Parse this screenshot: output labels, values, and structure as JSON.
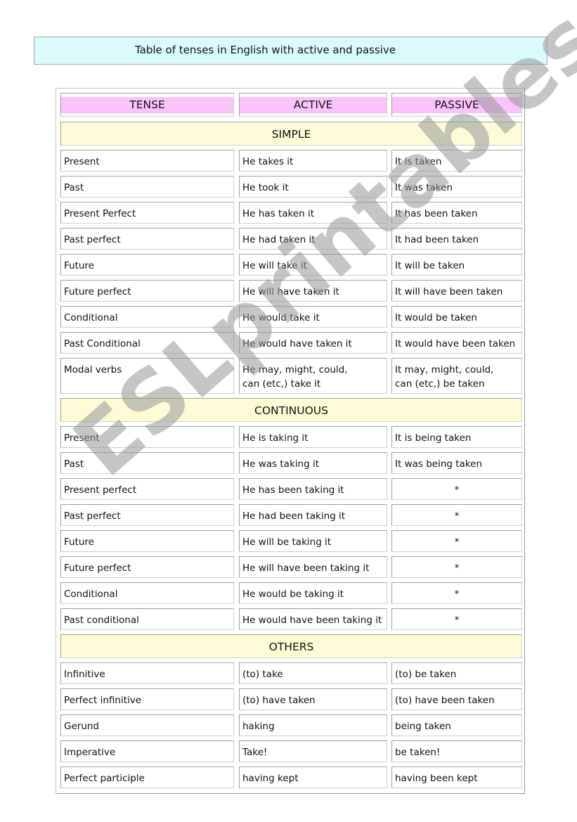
{
  "title": "Table of tenses in English with active and passive",
  "columns": [
    "TENSE",
    "ACTIVE",
    "PASSIVE"
  ],
  "sections": [
    {
      "name": "SIMPLE",
      "rows": [
        [
          "Present",
          "He takes it",
          "It is taken"
        ],
        [
          "Past",
          "He took it",
          "It was taken"
        ],
        [
          "Present Perfect",
          "He has taken it",
          "It has been taken"
        ],
        [
          "Past perfect",
          "He had taken it",
          "It had been taken"
        ],
        [
          "Future",
          "He will take it",
          "It will be taken"
        ],
        [
          "Future perfect",
          "He will have taken it",
          "It will have been taken"
        ],
        [
          "Conditional",
          "He would take it",
          "It would be taken"
        ],
        [
          "Past Conditional",
          "He would have taken it",
          "It would have been taken"
        ],
        [
          "Modal verbs",
          "He may, might, could,\ncan (etc,) take it",
          "It may, might, could,\ncan (etc,) be taken"
        ]
      ]
    },
    {
      "name": "CONTINUOUS",
      "rows": [
        [
          "Present",
          "He is taking it",
          "It is being taken"
        ],
        [
          "Past",
          "He was taking it",
          "It was being taken"
        ],
        [
          "Present perfect",
          "He has been taking it",
          "*"
        ],
        [
          "Past perfect",
          "He had been taking it",
          "*"
        ],
        [
          "Future",
          "He will be taking it",
          "*"
        ],
        [
          "Future perfect",
          "He will have been taking it",
          "*"
        ],
        [
          "Conditional",
          "He would be taking it",
          "*"
        ],
        [
          "Past conditional",
          "He would have been taking  it",
          "*"
        ]
      ]
    },
    {
      "name": "OTHERS",
      "rows": [
        [
          "Infinitive",
          "(to) take",
          "(to) be taken"
        ],
        [
          "Perfect infinitive",
          "(to) have taken",
          "(to) have been taken"
        ],
        [
          "Gerund",
          "haking",
          "being taken"
        ],
        [
          "Imperative",
          "Take!",
          "be taken!"
        ],
        [
          "Perfect participle",
          "having kept",
          "having been kept"
        ]
      ]
    }
  ],
  "watermark": "ESLprintables.com",
  "colors": {
    "title_bg": "#d9fbfb",
    "header_band": "#fbc3fb",
    "section_bg": "#fdfcd6"
  }
}
